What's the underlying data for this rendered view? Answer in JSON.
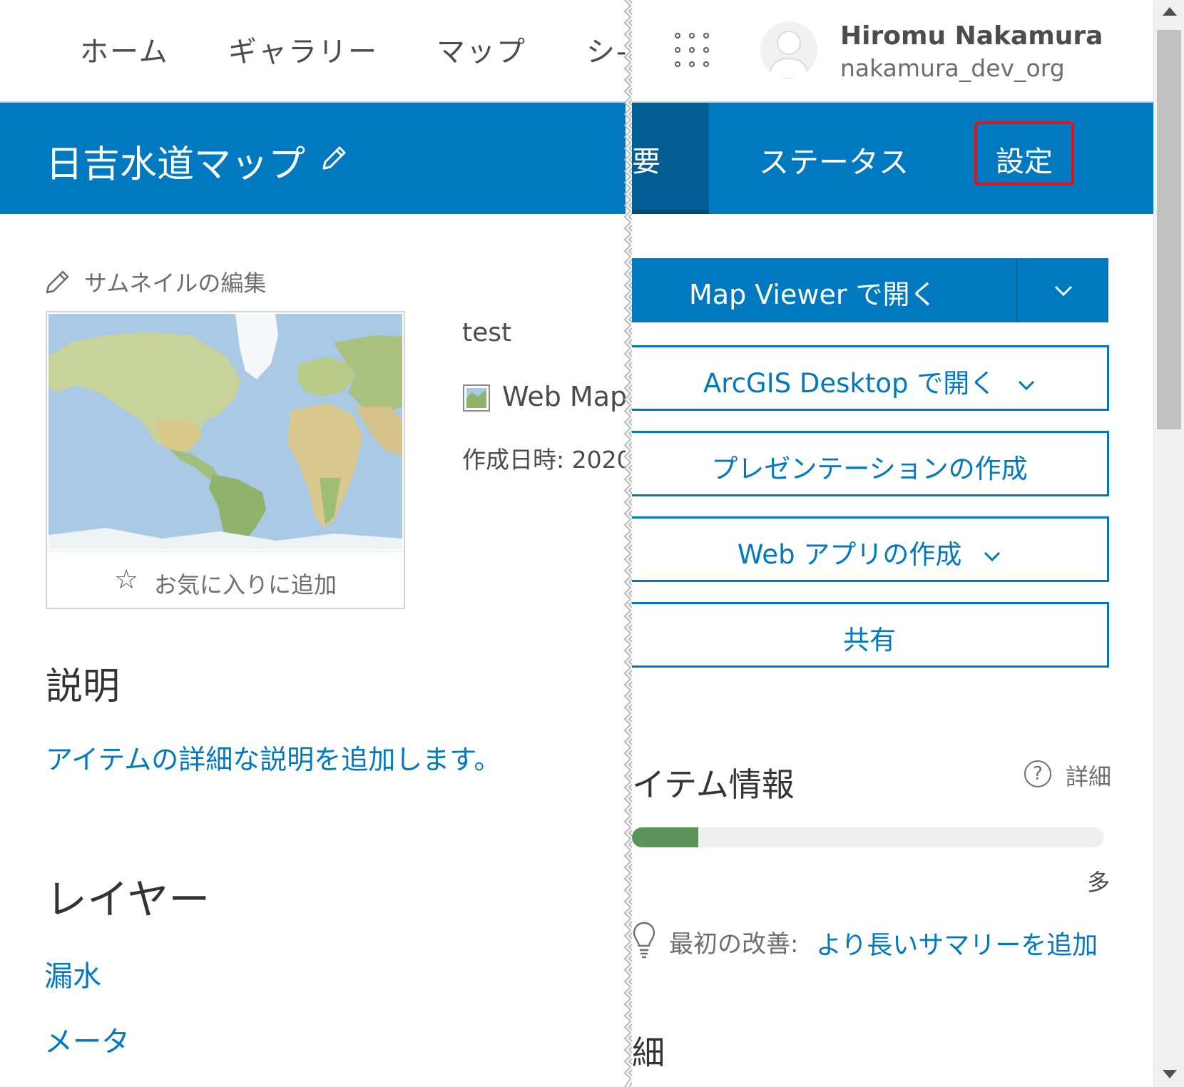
{
  "nav": {
    "items": [
      "ホーム",
      "ギャラリー",
      "マップ",
      "シ-"
    ]
  },
  "user": {
    "name": "Hiromu Nakamura",
    "org": "nakamura_dev_org"
  },
  "item": {
    "title": "日吉水道マップ",
    "thumbnail_edit": "サムネイルの編集",
    "favorite": "お気に入りに追加",
    "summary": "test",
    "type": "Web Map",
    "created": "作成日時: 2020"
  },
  "description": {
    "heading": "説明",
    "add_link": "アイテムの詳細な説明を追加します。"
  },
  "layers": {
    "heading": "レイヤー",
    "items": [
      "漏水",
      "メータ"
    ]
  },
  "tabs": {
    "overview": "要",
    "status": "ステータス",
    "settings": "設定"
  },
  "actions": {
    "open_map_viewer": "Map Viewer で開く",
    "open_desktop": "ArcGIS Desktop で開く",
    "create_presentation": "プレゼンテーションの作成",
    "create_web_app": "Web アプリの作成",
    "share": "共有"
  },
  "item_info": {
    "heading": "イテム情報",
    "help": "詳細",
    "progress_fraction": 0.14,
    "progress_label": "多",
    "tip_label": "最初の改善:",
    "tip_link": "より長いサマリーを追加"
  },
  "details": {
    "heading": "細"
  },
  "colors": {
    "brand_blue": "#0079c1",
    "highlight_red": "#e01414",
    "progress_green": "#5a9458"
  }
}
